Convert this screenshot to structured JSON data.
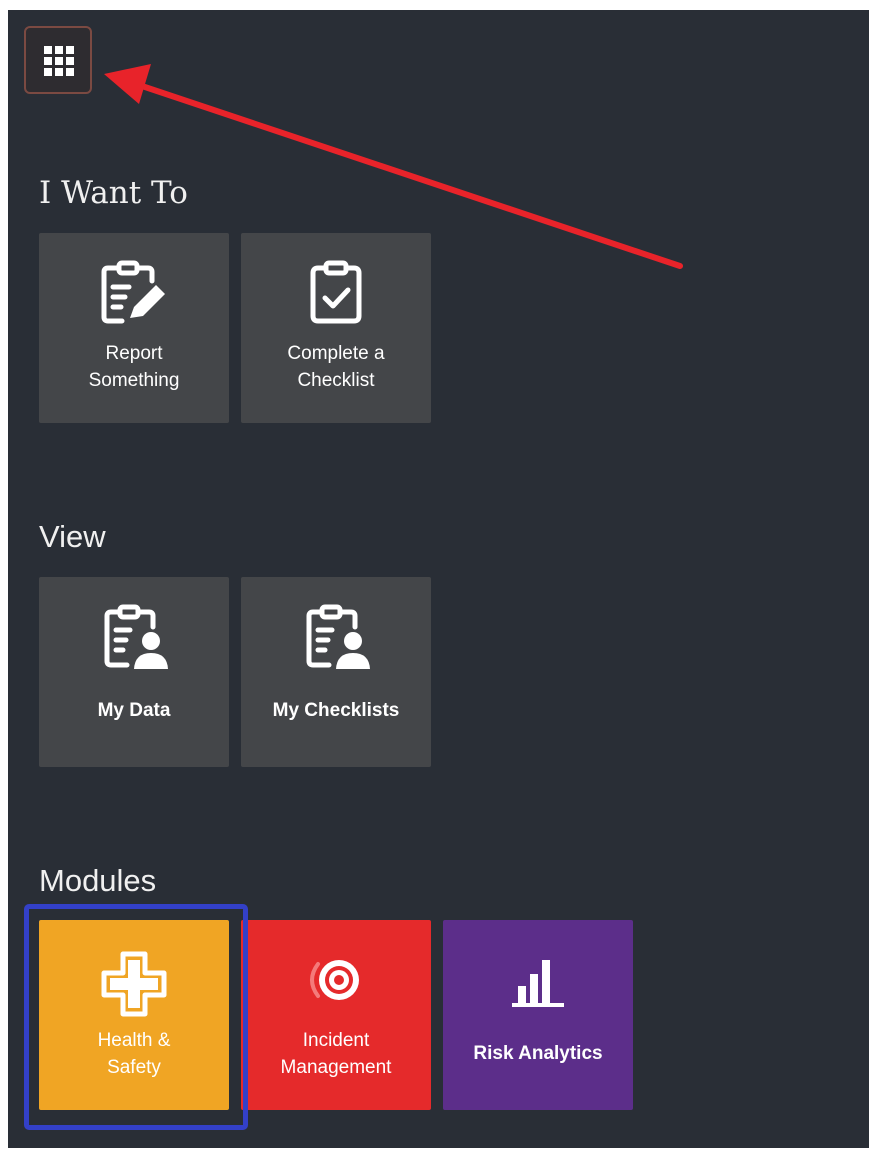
{
  "launcher": {
    "icon": "grid-icon"
  },
  "sections": {
    "i_want_to": {
      "title": "I Want To",
      "tiles": [
        {
          "label": "Report\nSomething",
          "icon": "clipboard-pencil-icon"
        },
        {
          "label": "Complete a\nChecklist",
          "icon": "clipboard-check-icon"
        }
      ]
    },
    "view": {
      "title": "View",
      "tiles": [
        {
          "label": "My Data",
          "icon": "clipboard-person-icon"
        },
        {
          "label": "My Checklists",
          "icon": "clipboard-person-icon"
        }
      ]
    },
    "modules": {
      "title": "Modules",
      "tiles": [
        {
          "label": "Health &\nSafety",
          "icon": "medical-cross-icon",
          "color": "#f0a524"
        },
        {
          "label": "Incident\nManagement",
          "icon": "target-icon",
          "color": "#e52a2b"
        },
        {
          "label": "Risk Analytics",
          "icon": "bar-chart-icon",
          "color": "#5c2e8a"
        }
      ]
    }
  },
  "colors": {
    "panel_background": "#292e36",
    "tile_gray": "#444649",
    "annotation_arrow": "#e8232a",
    "annotation_highlight": "#3340c8"
  }
}
